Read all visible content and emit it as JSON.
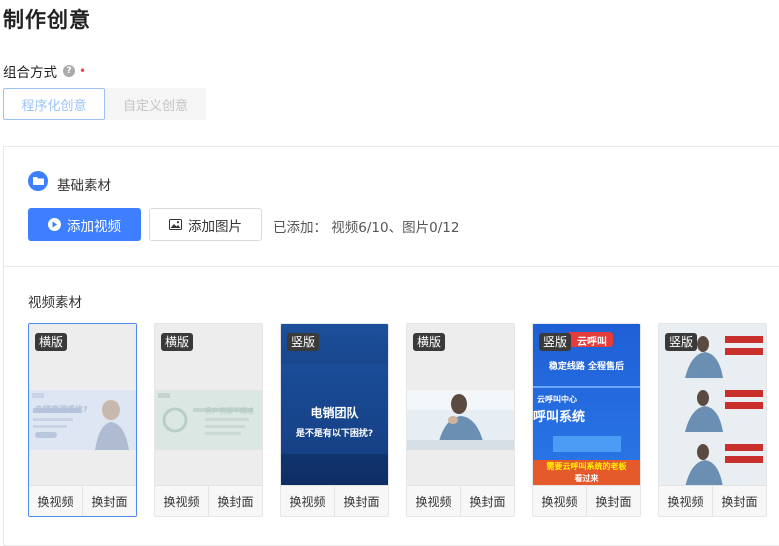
{
  "page": {
    "title": "制作创意"
  },
  "combo": {
    "label": "组合方式",
    "help_icon": "?",
    "required_mark": "•",
    "options": [
      {
        "label": "程序化创意",
        "active": true
      },
      {
        "label": "自定义创意",
        "active": false
      }
    ]
  },
  "basic": {
    "label": "基础素材",
    "add_video_label": "添加视频",
    "add_image_label": "添加图片",
    "added_text": "已添加： 视频6/10、图片0/12"
  },
  "videos": {
    "label": "视频素材",
    "cards": [
      {
        "badge": "横版",
        "selected": true,
        "thumb_texts": [
          "电销客源难找?"
        ],
        "replace_video": "换视频",
        "replace_cover": "换封面"
      },
      {
        "badge": "横版",
        "selected": false,
        "thumb_texts": [
          "客户资源不精准"
        ],
        "replace_video": "换视频",
        "replace_cover": "换封面"
      },
      {
        "badge": "竖版",
        "selected": false,
        "thumb_texts": [
          "电销团队",
          "是不是有以下困扰?"
        ],
        "replace_video": "换视频",
        "replace_cover": "换封面"
      },
      {
        "badge": "横版",
        "selected": false,
        "thumb_texts": [],
        "replace_video": "换视频",
        "replace_cover": "换封面"
      },
      {
        "badge": "竖版",
        "selected": false,
        "thumb_texts": [
          "云呼叫",
          "稳定线路 全程售后",
          "云呼叫中心",
          "呼叫系统",
          "需要云呼叫系统的老板",
          "看过来"
        ],
        "replace_video": "换视频",
        "replace_cover": "换封面"
      },
      {
        "badge": "竖版",
        "selected": false,
        "thumb_texts": [],
        "replace_video": "换视频",
        "replace_cover": "换封面"
      }
    ]
  },
  "colors": {
    "accent": "#3d7fff",
    "active_seg": "#9cc3f5",
    "required": "#f04b4b"
  }
}
